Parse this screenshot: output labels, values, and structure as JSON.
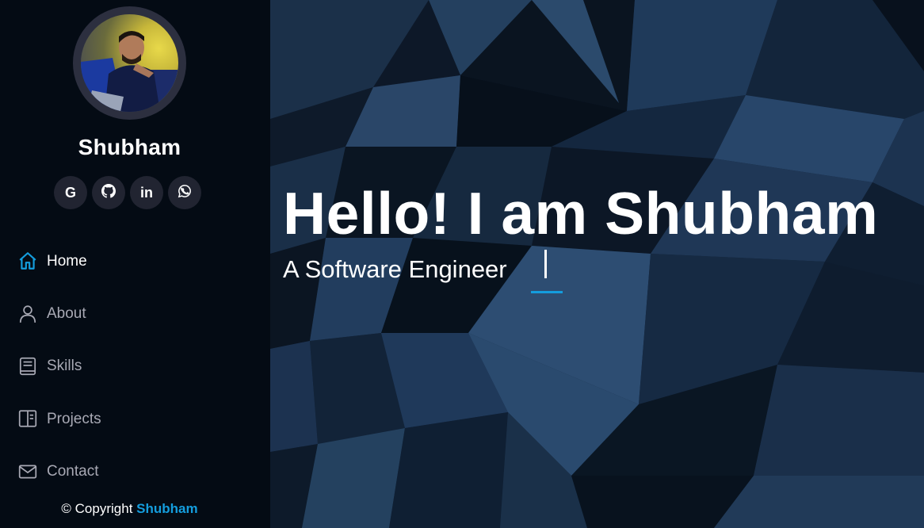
{
  "profile": {
    "name": "Shubham"
  },
  "socials": [
    {
      "label": "G",
      "icon": "google-icon"
    },
    {
      "label": "",
      "icon": "github-icon"
    },
    {
      "label": "in",
      "icon": "linkedin-icon"
    },
    {
      "label": "",
      "icon": "whatsapp-icon"
    }
  ],
  "nav": [
    {
      "label": "Home",
      "icon": "home-icon",
      "active": true
    },
    {
      "label": "About",
      "icon": "person-icon",
      "active": false
    },
    {
      "label": "Skills",
      "icon": "book-icon",
      "active": false
    },
    {
      "label": "Projects",
      "icon": "layout-icon",
      "active": false
    },
    {
      "label": "Contact",
      "icon": "envelope-icon",
      "active": false
    }
  ],
  "footer": {
    "copyright_prefix": "© Copyright ",
    "copyright_brand": "Shubham"
  },
  "hero": {
    "title": "Hello! I am Shubham",
    "subtitle": "A Software Engineer"
  },
  "colors": {
    "accent": "#149ddd",
    "sidebar_bg": "#040b14",
    "social_bg": "#212431"
  }
}
